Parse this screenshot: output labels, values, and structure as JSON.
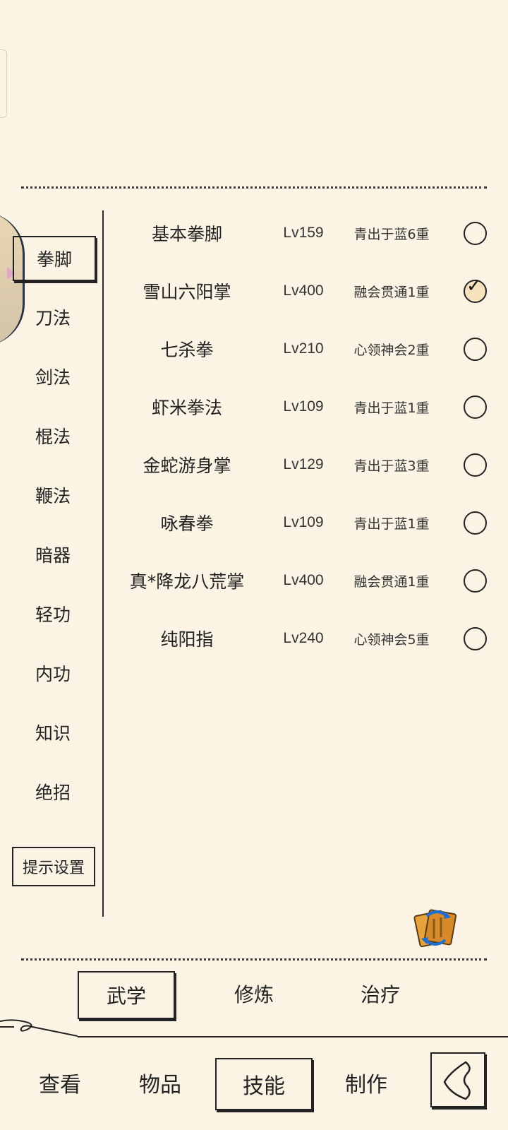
{
  "categories": [
    {
      "label": "拳脚",
      "active": true
    },
    {
      "label": "刀法",
      "active": false
    },
    {
      "label": "剑法",
      "active": false
    },
    {
      "label": "棍法",
      "active": false
    },
    {
      "label": "鞭法",
      "active": false
    },
    {
      "label": "暗器",
      "active": false
    },
    {
      "label": "轻功",
      "active": false
    },
    {
      "label": "内功",
      "active": false
    },
    {
      "label": "知识",
      "active": false
    },
    {
      "label": "绝招",
      "active": false
    }
  ],
  "hint_settings_label": "提示设置",
  "skills": [
    {
      "name": "基本拳脚",
      "level": "Lv159",
      "rank": "青出于蓝6重",
      "selected": false
    },
    {
      "name": "雪山六阳掌",
      "level": "Lv400",
      "rank": "融会贯通1重",
      "selected": true
    },
    {
      "name": "七杀拳",
      "level": "Lv210",
      "rank": "心领神会2重",
      "selected": false
    },
    {
      "name": "虾米拳法",
      "level": "Lv109",
      "rank": "青出于蓝1重",
      "selected": false
    },
    {
      "name": "金蛇游身掌",
      "level": "Lv129",
      "rank": "青出于蓝3重",
      "selected": false
    },
    {
      "name": "咏春拳",
      "level": "Lv109",
      "rank": "青出于蓝1重",
      "selected": false
    },
    {
      "name": "真*降龙八荒掌",
      "level": "Lv400",
      "rank": "融会贯通1重",
      "selected": false
    },
    {
      "name": "纯阳指",
      "level": "Lv240",
      "rank": "心领神会5重",
      "selected": false
    }
  ],
  "sub_tabs": [
    {
      "label": "武学",
      "active": true
    },
    {
      "label": "修炼",
      "active": false
    },
    {
      "label": "治疗",
      "active": false
    }
  ],
  "nav_tabs": [
    {
      "label": "查看",
      "active": false
    },
    {
      "label": "物品",
      "active": false
    },
    {
      "label": "技能",
      "active": true
    },
    {
      "label": "制作",
      "active": false
    }
  ],
  "icons": {
    "swap": "swap-skills-icon",
    "back": "back-arrow-icon",
    "check": "checkmark-icon"
  }
}
